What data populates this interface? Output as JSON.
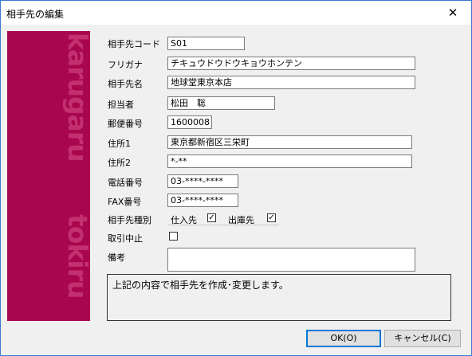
{
  "window": {
    "title": "相手先の編集",
    "close_glyph": "✕"
  },
  "branding": {
    "text_top": "karugaru",
    "text_bottom": "tokiru",
    "color": "#a8064e"
  },
  "form": {
    "code": {
      "label": "相手先コード",
      "value": "S01"
    },
    "furigana": {
      "label": "フリガナ",
      "value": "チキュウドウドウキョウホンテン"
    },
    "name": {
      "label": "相手先名",
      "value": "地球堂東京本店"
    },
    "person": {
      "label": "担当者",
      "value": "松田　聡"
    },
    "postal": {
      "label": "郵便番号",
      "value": "1600008"
    },
    "address1": {
      "label": "住所1",
      "value": "東京都新宿区三栄町"
    },
    "address2": {
      "label": "住所2",
      "value": "*-**"
    },
    "phone": {
      "label": "電話番号",
      "value": "03-****-****"
    },
    "fax": {
      "label": "FAX番号",
      "value": "03-****-****"
    },
    "type": {
      "label": "相手先種別",
      "supplier": {
        "label": "仕入先",
        "checked": true
      },
      "customer": {
        "label": "出庫先",
        "checked": true
      }
    },
    "suspended": {
      "label": "取引中止",
      "checked": false
    },
    "notes": {
      "label": "備考",
      "value": ""
    }
  },
  "message": "上記の内容で相手先を作成･変更します。",
  "buttons": {
    "ok": "OK(O)",
    "cancel": "キャンセル(C)"
  }
}
